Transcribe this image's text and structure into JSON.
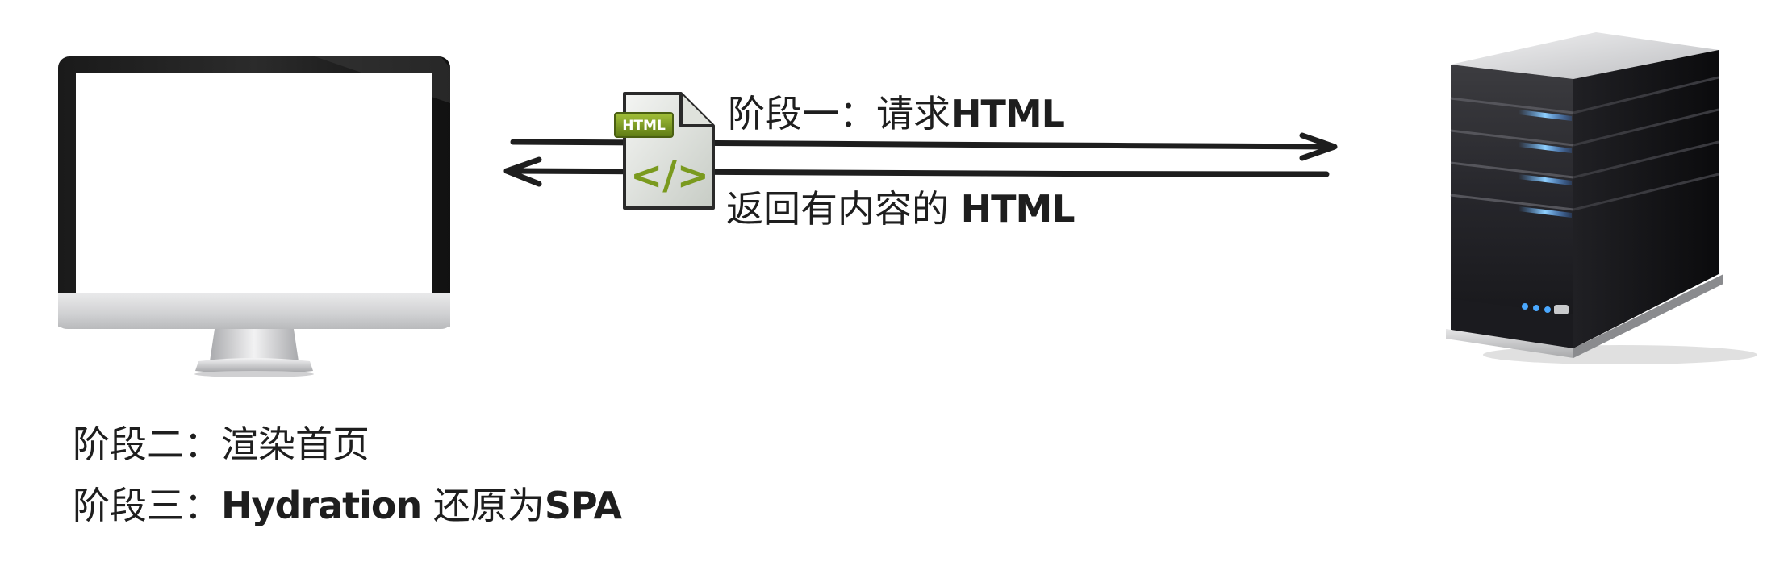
{
  "diagram": {
    "client": {
      "icon": "monitor-icon"
    },
    "server": {
      "icon": "server-tower-icon"
    },
    "document": {
      "icon": "html-file-icon",
      "badge_text": "HTML",
      "code_glyph": "</>"
    },
    "request": {
      "prefix": "阶段一：请求",
      "suffix": "HTML"
    },
    "response": {
      "prefix": "返回有内容的 ",
      "suffix": "HTML"
    },
    "stage_two": {
      "text": "阶段二：渲染首页"
    },
    "stage_three": {
      "prefix": "阶段三：",
      "highlight": "Hydration",
      "middle": " 还原为",
      "suffix": "SPA"
    }
  }
}
